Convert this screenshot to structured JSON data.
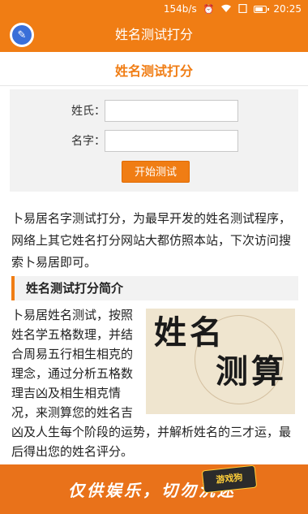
{
  "status": {
    "speed": "154b/s",
    "time": "20:25",
    "icons": [
      "alarm-icon",
      "wifi-icon",
      "sim-icon",
      "battery-icon"
    ]
  },
  "appbar": {
    "title": "姓名测试打分",
    "icon": "app-logo-icon"
  },
  "page": {
    "heading": "姓名测试打分"
  },
  "form": {
    "surname_label": "姓氏：",
    "surname_value": "",
    "name_label": "名字：",
    "name_value": "",
    "submit_label": "开始测试"
  },
  "intro": "卜易居名字测试打分，为最早开发的姓名测试程序，网络上其它姓名打分网站大都仿照本站，下次访问搜索卜易居即可。",
  "section": {
    "title": "姓名测试打分简介",
    "image_text_1": "姓名",
    "image_text_2": "测算",
    "body": "卜易居姓名测试，按照姓名学五格数理，并结合周易五行相生相克的理念，通过分析五格数理吉凶及相生相克情况，来测算您的姓名吉凶及人生每个阶段的运势，并解析姓名的三才运，最后得出您的姓名评分。"
  },
  "banner": {
    "slogan": "仅供娱乐，切勿沉迷",
    "badge": "游戏狗"
  },
  "colors": {
    "accent": "#f07d14",
    "banner": "#e9721a",
    "panel": "#f2f2f2"
  }
}
